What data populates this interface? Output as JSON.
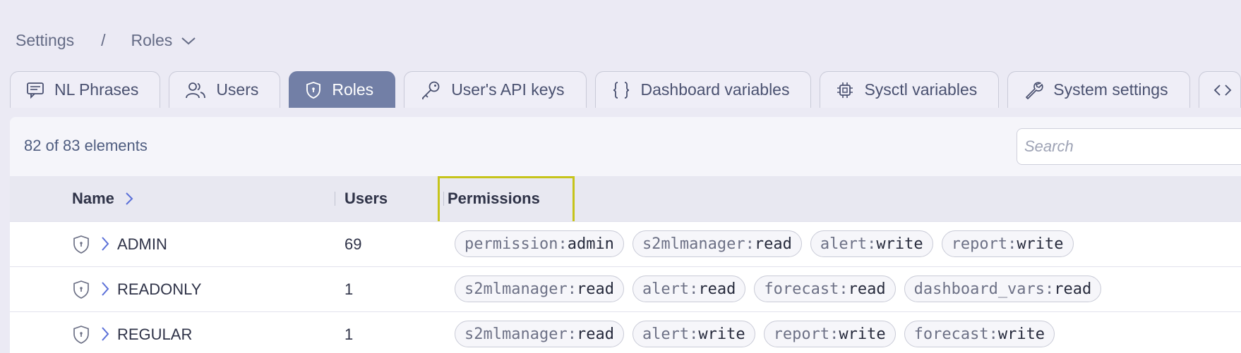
{
  "breadcrumb": {
    "root": "Settings",
    "separator": "/",
    "current": "Roles"
  },
  "tabs": [
    {
      "label": "NL Phrases",
      "icon": "chat-icon"
    },
    {
      "label": "Users",
      "icon": "users-icon"
    },
    {
      "label": "Roles",
      "icon": "shield-icon",
      "active": true
    },
    {
      "label": "User's API keys",
      "icon": "key-icon"
    },
    {
      "label": "Dashboard variables",
      "icon": "braces-icon"
    },
    {
      "label": "Sysctl variables",
      "icon": "chip-icon"
    },
    {
      "label": "System settings",
      "icon": "wrench-icon"
    }
  ],
  "list": {
    "count_text": "82 of 83 elements",
    "search_placeholder": "Search",
    "columns": {
      "name": "Name",
      "users": "Users",
      "permissions": "Permissions"
    },
    "rows": [
      {
        "name": "ADMIN",
        "users": "69",
        "permissions": [
          {
            "k": "permission:",
            "v": "admin"
          },
          {
            "k": "s2mlmanager:",
            "v": "read"
          },
          {
            "k": "alert:",
            "v": "write"
          },
          {
            "k": "report:",
            "v": "write"
          }
        ]
      },
      {
        "name": "READONLY",
        "users": "1",
        "permissions": [
          {
            "k": "s2mlmanager:",
            "v": "read"
          },
          {
            "k": "alert:",
            "v": "read"
          },
          {
            "k": "forecast:",
            "v": "read"
          },
          {
            "k": "dashboard_vars:",
            "v": "read"
          }
        ]
      },
      {
        "name": "REGULAR",
        "users": "1",
        "permissions": [
          {
            "k": "s2mlmanager:",
            "v": "read"
          },
          {
            "k": "alert:",
            "v": "write"
          },
          {
            "k": "report:",
            "v": "write"
          },
          {
            "k": "forecast:",
            "v": "write"
          }
        ]
      }
    ]
  },
  "colors": {
    "accent": "#727fa6",
    "highlight": "#c6c41b",
    "link": "#5a6fd8"
  }
}
